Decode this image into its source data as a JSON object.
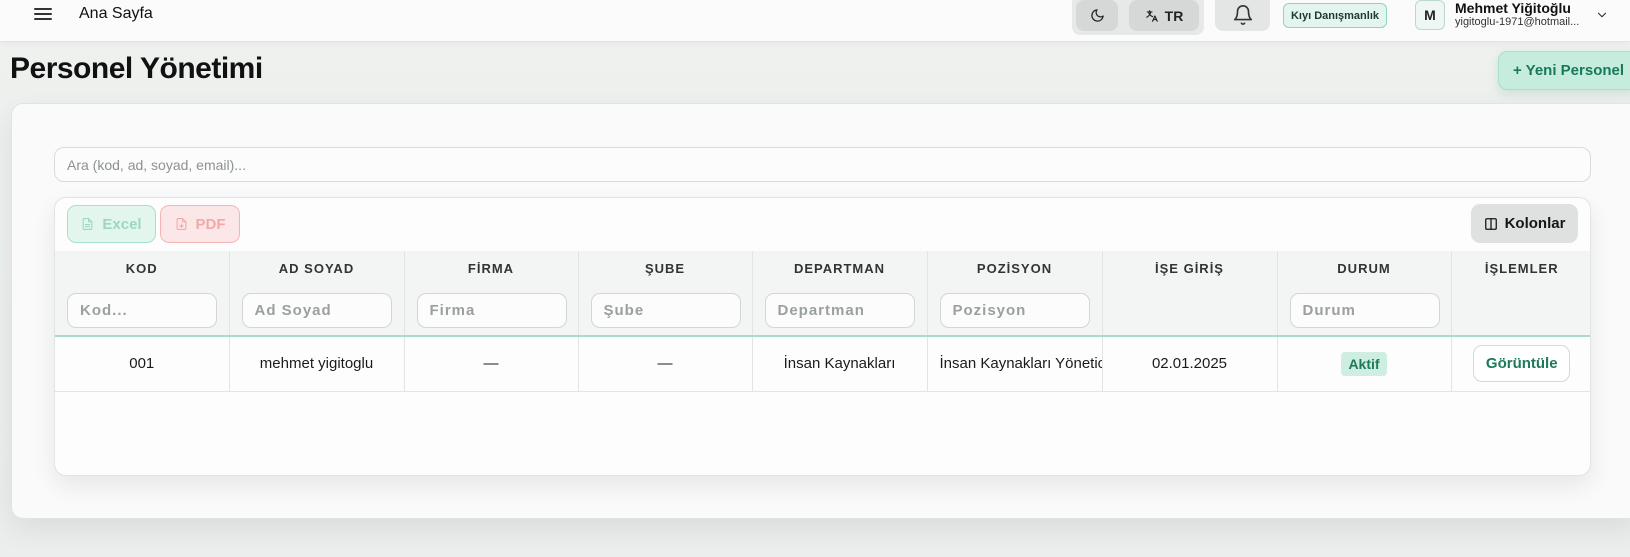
{
  "topbar": {
    "home_title": "Ana Sayfa",
    "language": "TR",
    "company": "Kıyı Danışmanlık",
    "user": {
      "initial": "M",
      "name": "Mehmet Yiğitoğlu",
      "email": "yigitoglu-1971@hotmail..."
    },
    "icons": [
      "hamburger-menu-icon",
      "moon-icon",
      "translate-icon",
      "bell-icon",
      "chevron-down-icon"
    ]
  },
  "page": {
    "title": "Personel Yönetimi",
    "new_button": "+ Yeni Personel"
  },
  "search": {
    "placeholder": "Ara (kod, ad, soyad, email)..."
  },
  "toolbar": {
    "excel_label": "Excel",
    "pdf_label": "PDF",
    "columns_label": "Kolonlar"
  },
  "table": {
    "headers": [
      "KOD",
      "AD SOYAD",
      "FİRMA",
      "ŞUBE",
      "DEPARTMAN",
      "POZİSYON",
      "İŞE GİRİŞ",
      "DURUM",
      "İŞLEMLER"
    ],
    "filters": [
      "Kod...",
      "Ad Soyad",
      "Firma",
      "Şube",
      "Departman",
      "Pozisyon",
      "",
      "Durum",
      ""
    ],
    "rows": [
      {
        "kod": "001",
        "ad_soyad": "mehmet yigitoglu",
        "firma": "—",
        "sube": "—",
        "departman": "İnsan Kaynakları",
        "pozisyon": "İnsan Kaynakları Yönetic",
        "ise_giris": "02.01.2025",
        "durum": "Aktif",
        "islem": "Görüntüle"
      }
    ]
  },
  "colors": {
    "accent": "#177a5a",
    "accent_light": "#c5ecdd",
    "status_active_bg": "#cdeee0"
  }
}
